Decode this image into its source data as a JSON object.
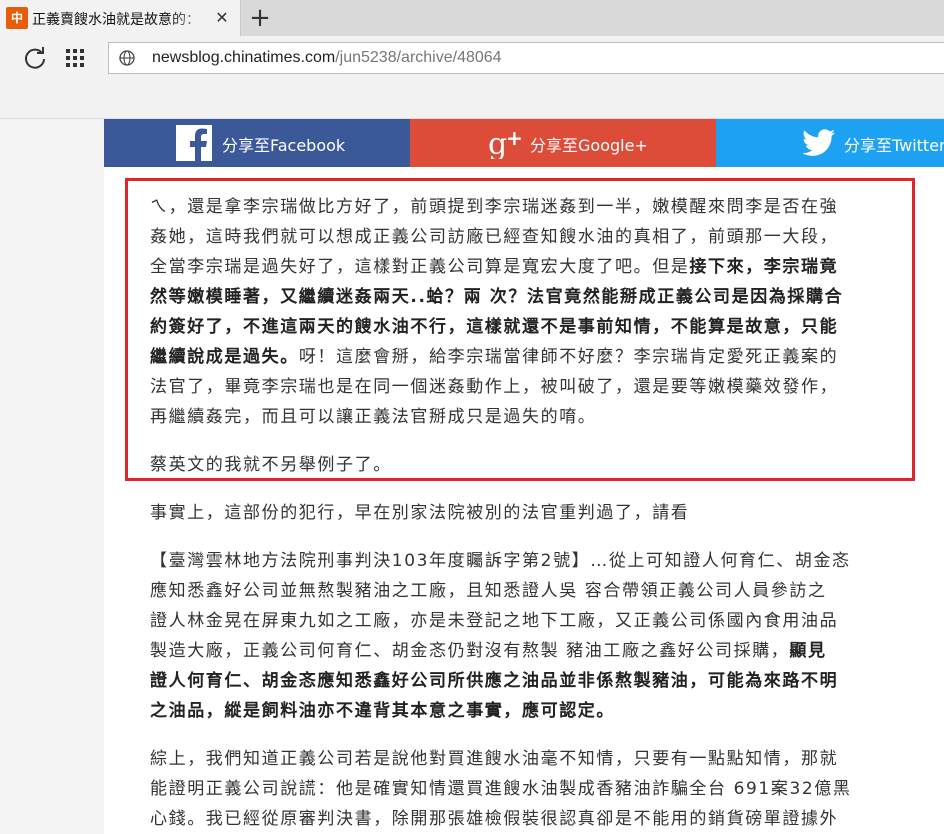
{
  "browser": {
    "tab": {
      "favicon_text": "中",
      "title": "正義賣餿水油就是故意的："
    },
    "new_tab_symbol": "+",
    "close_symbol": "✕",
    "address": {
      "host": "newsblog.chinatimes.com",
      "path": "/jun5238/archive/48064"
    }
  },
  "share": {
    "facebook": "分享至Facebook",
    "google": "分享至Google+",
    "twitter": "分享至Twitter"
  },
  "colors": {
    "facebook": "#3b5998",
    "google": "#dd4b39",
    "twitter": "#1da1f2",
    "highlight_border": "#e0252f"
  },
  "article": {
    "p1": [
      "ㄟ，還是拿李宗瑞做比方好了，前頭提到李宗瑞迷姦到一半，嫩模醒來問李是否在強",
      "姦她，這時我們就可以想成正義公司訪廠已經查知餿水油的真相了，前頭那一大段，",
      "全當李宗瑞是過失好了，這樣對正義公司算是寬宏大度了吧。但是接下來，李宗瑞竟",
      "然等嫩模睡著，又繼續迷姦兩天..蛤？兩 次？法官竟然能掰成正義公司是因為採購合",
      "約簽好了，不進這兩天的餿水油不行，這樣就還不是事前知情，不能算是故意，只能",
      "繼續說成是過失。呀！這麼會掰，給李宗瑞當律師不好麼？李宗瑞肯定愛死正義案的",
      "法官了，畢竟李宗瑞也是在同一個迷姦動作上，被叫破了，還是要等嫩模藥效發作，",
      "再繼續姦完，而且可以讓正義法官掰成只是過失的唷。"
    ],
    "p2": "蔡英文的我就不另舉例子了。",
    "p3": "事實上，這部份的犯行，早在別家法院被別的法官重判過了，請看",
    "p4": [
      "【臺灣雲林地方法院刑事判決103年度矚訴字第2號】…從上可知證人何育仁、胡金忞",
      "應知悉鑫好公司並無熬製豬油之工廠，且知悉證人吳 容合帶領正義公司人員參訪之",
      "證人林金晃在屏東九如之工廠，亦是未登記之地下工廠，又正義公司係國內食用油品",
      "製造大廠，正義公司何育仁、胡金忞仍對沒有熬製 豬油工廠之鑫好公司採購，顯見",
      "證人何育仁、胡金忞應知悉鑫好公司所供應之油品並非係熬製豬油，可能為來路不明",
      "之油品，縱是飼料油亦不違背其本意之事實，應可認定。"
    ],
    "p5": [
      "綜上，我們知道正義公司若是說他對買進餿水油毫不知情，只要有一點點知情，那就",
      "能證明正義公司說謊：他是確實知情還買進餿水油製成香豬油詐騙全台 691案32億黑",
      "心錢。我已經從原審判決書，除開那張雄檢假裝很認真卻是不能用的銷貨磅單證據外"
    ]
  }
}
